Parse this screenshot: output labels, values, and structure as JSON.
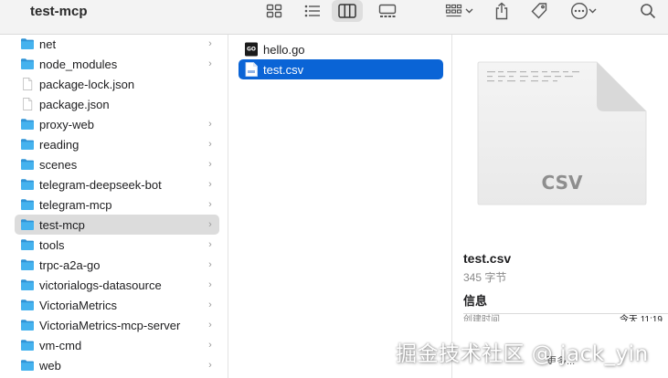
{
  "window": {
    "title": "test-mcp"
  },
  "toolbar": {
    "icons": [
      "icon-view-icon",
      "list-view-icon",
      "column-view-icon",
      "gallery-view-icon",
      "group-icon",
      "chevron-down-icon",
      "share-icon",
      "tag-icon",
      "more-icon",
      "chevron-down-icon",
      "search-icon"
    ],
    "active_view": "column-view"
  },
  "column1": {
    "items": [
      {
        "label": "net",
        "type": "folder",
        "chevron": "›"
      },
      {
        "label": "node_modules",
        "type": "folder",
        "chevron": "›"
      },
      {
        "label": "package-lock.json",
        "type": "file",
        "chevron": ""
      },
      {
        "label": "package.json",
        "type": "file",
        "chevron": ""
      },
      {
        "label": "proxy-web",
        "type": "folder",
        "chevron": "›"
      },
      {
        "label": "reading",
        "type": "folder",
        "chevron": "›"
      },
      {
        "label": "scenes",
        "type": "folder",
        "chevron": "›"
      },
      {
        "label": "telegram-deepseek-bot",
        "type": "folder",
        "chevron": "›"
      },
      {
        "label": "telegram-mcp",
        "type": "folder",
        "chevron": "›"
      },
      {
        "label": "test-mcp",
        "type": "folder",
        "chevron": "›",
        "selected": true
      },
      {
        "label": "tools",
        "type": "folder",
        "chevron": "›"
      },
      {
        "label": "trpc-a2a-go",
        "type": "folder",
        "chevron": "›"
      },
      {
        "label": "victorialogs-datasource",
        "type": "folder",
        "chevron": "›"
      },
      {
        "label": "VictoriaMetrics",
        "type": "folder",
        "chevron": "›"
      },
      {
        "label": "VictoriaMetrics-mcp-server",
        "type": "folder",
        "chevron": "›"
      },
      {
        "label": "vm-cmd",
        "type": "folder",
        "chevron": "›"
      },
      {
        "label": "web",
        "type": "folder",
        "chevron": "›"
      }
    ]
  },
  "column2": {
    "items": [
      {
        "label": "hello.go",
        "type": "go-file",
        "badge": "GO"
      },
      {
        "label": "test.csv",
        "type": "csv-file",
        "selected": true
      }
    ]
  },
  "preview": {
    "thumbnail_label": "CSV",
    "file_name": "test.csv",
    "file_size": "345 字节",
    "info_heading": "信息",
    "created_label": "创建时间",
    "created_value": "今天 11:19",
    "more_label": "更多..."
  },
  "watermark": {
    "text": "掘金技术社区 @ jack_yin"
  },
  "colors": {
    "selection_blue": "#0a64d6",
    "folder_blue": "#3ca9e8",
    "toolbar_bg": "#f3f3f3"
  }
}
